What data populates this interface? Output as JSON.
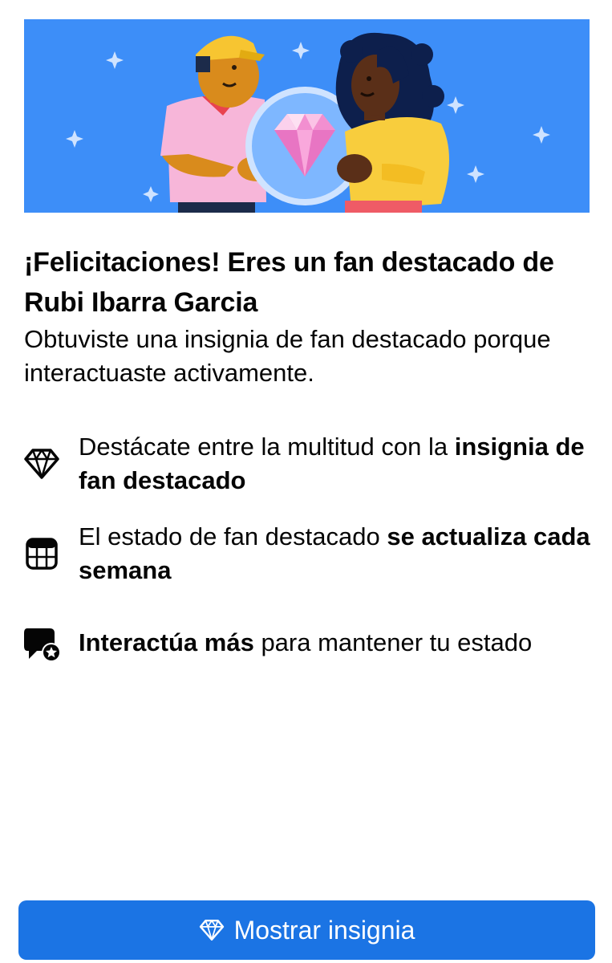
{
  "banner": {
    "background_color": "#3d8ef8",
    "illustration": "two-fans-holding-diamond-badge"
  },
  "title": "¡Felicitaciones! Eres un fan destacado de Rubi Ibarra Garcia",
  "subtitle": "Obtuviste una insignia de fan destacado porque interactuaste activamente.",
  "features": [
    {
      "icon": "diamond-icon",
      "text_regular": "Destácate entre la multitud con la ",
      "text_bold": "insignia de fan destacado"
    },
    {
      "icon": "calendar-icon",
      "text_regular": "El estado de fan destacado ",
      "text_bold": "se actualiza cada semana"
    },
    {
      "icon": "chat-star-icon",
      "text_bold": "Interactúa más",
      "text_regular": " para mantener tu estado"
    }
  ],
  "cta": {
    "label": "Mostrar insignia",
    "icon": "diamond-icon",
    "color": "#1b74e4"
  }
}
